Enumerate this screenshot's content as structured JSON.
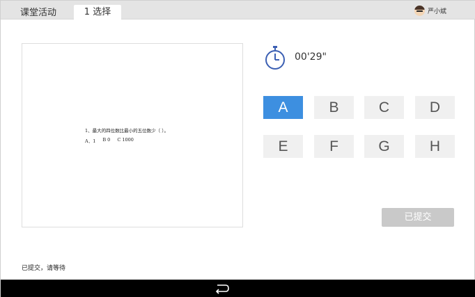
{
  "header": {
    "app_title": "课堂活动",
    "tab_label": "1 选择",
    "user_name": "严小斌"
  },
  "question": {
    "text": "1、最大的四位数比最小的五位数少（    ）。",
    "options": [
      "A．1",
      "B 0",
      "C 1000"
    ]
  },
  "timer": {
    "value": "00'29\""
  },
  "answers": {
    "options": [
      "A",
      "B",
      "C",
      "D",
      "E",
      "F",
      "G",
      "H"
    ],
    "selected": "A"
  },
  "submit": {
    "label": "已提交"
  },
  "status": {
    "text": "已提交，请等待"
  },
  "colors": {
    "accent": "#3d8fe0",
    "topbar": "#e4e4e4",
    "disabled_button": "#c9c9c9",
    "navbar": "#000000"
  },
  "icons": {
    "timer": "stopwatch-icon",
    "back": "back-arrow-icon",
    "avatar": "user-avatar-icon"
  }
}
